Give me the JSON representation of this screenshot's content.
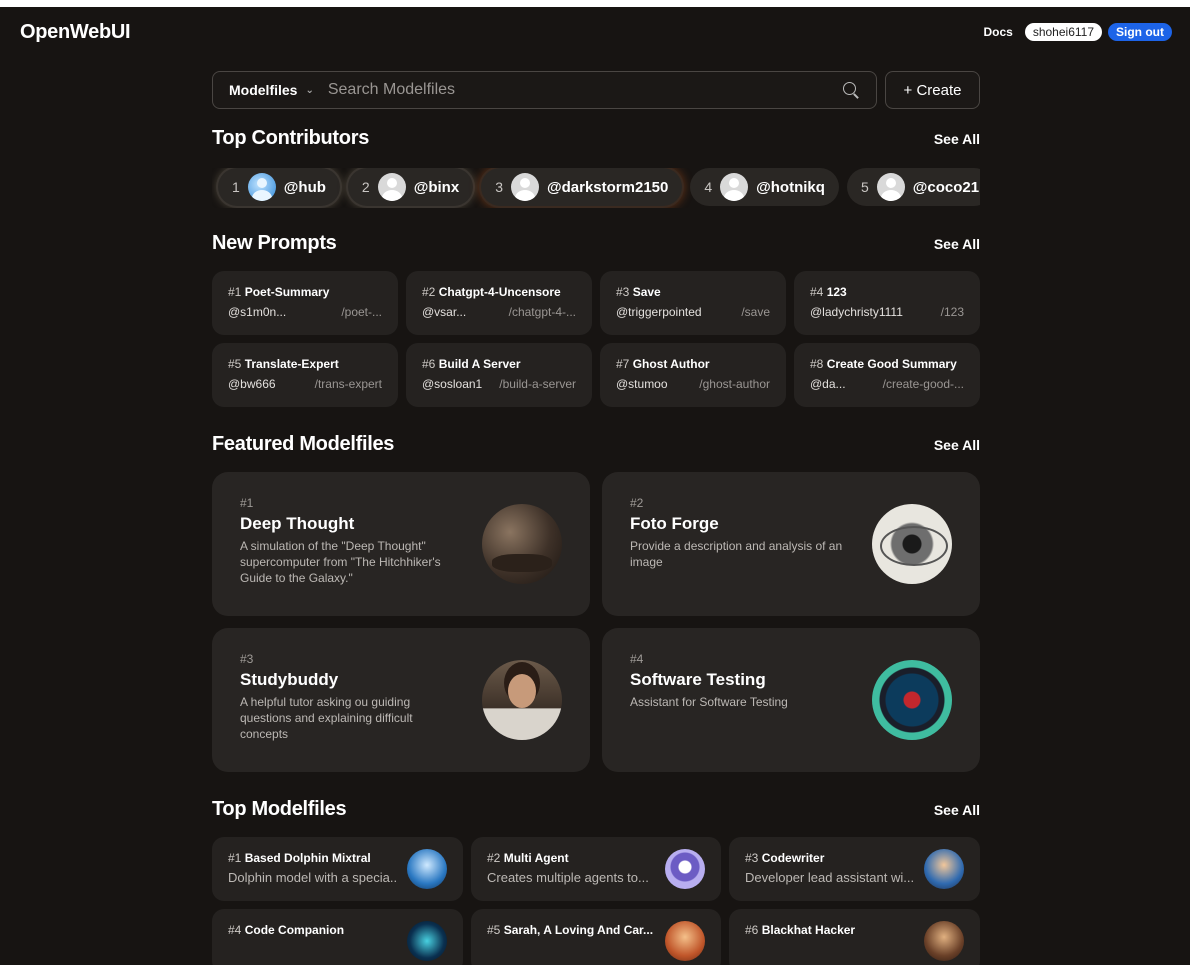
{
  "app": {
    "title": "OpenWebUI"
  },
  "header": {
    "docs": "Docs",
    "username": "shohei6117",
    "signout": "Sign out"
  },
  "search": {
    "selector": "Modelfiles",
    "placeholder": "Search Modelfiles",
    "create": "+ Create"
  },
  "contributors": {
    "title": "Top Contributors",
    "see_all": "See All",
    "items": [
      {
        "rank": "1",
        "name": "@hub"
      },
      {
        "rank": "2",
        "name": "@binx"
      },
      {
        "rank": "3",
        "name": "@darkstorm2150"
      },
      {
        "rank": "4",
        "name": "@hotnikq"
      },
      {
        "rank": "5",
        "name": "@coco21"
      }
    ]
  },
  "prompts": {
    "title": "New Prompts",
    "see_all": "See All",
    "items": [
      {
        "num": "#1",
        "title": "Poet-Summary",
        "user": "@s1m0n...",
        "command": "/poet-..."
      },
      {
        "num": "#2",
        "title": "Chatgpt-4-Uncensore",
        "user": "@vsar...",
        "command": "/chatgpt-4-..."
      },
      {
        "num": "#3",
        "title": "Save",
        "user": "@triggerpointed",
        "command": "/save"
      },
      {
        "num": "#4",
        "title": "123",
        "user": "@ladychristy1111",
        "command": "/123"
      },
      {
        "num": "#5",
        "title": "Translate-Expert",
        "user": "@bw666",
        "command": "/trans-expert"
      },
      {
        "num": "#6",
        "title": "Build A Server",
        "user": "@sosloan1",
        "command": "/build-a-server"
      },
      {
        "num": "#7",
        "title": "Ghost Author",
        "user": "@stumoo",
        "command": "/ghost-author"
      },
      {
        "num": "#8",
        "title": "Create Good Summary",
        "user": "@da...",
        "command": "/create-good-..."
      }
    ]
  },
  "featured": {
    "title": "Featured Modelfiles",
    "see_all": "See All",
    "items": [
      {
        "num": "#1",
        "title": "Deep Thought",
        "desc": "A simulation of the \"Deep Thought\" supercomputer from \"The Hitchhiker's Guide to the Galaxy.\"",
        "image": "deep-thought-image"
      },
      {
        "num": "#2",
        "title": "Foto Forge",
        "desc": "Provide a description and analysis of an image",
        "image": "eye-image"
      },
      {
        "num": "#3",
        "title": "Studybuddy",
        "desc": "A helpful tutor asking ou guiding questions and explaining difficult concepts",
        "image": "tutor-image"
      },
      {
        "num": "#4",
        "title": "Software Testing",
        "desc": "Assistant for Software Testing",
        "image": "bug-hunter-image"
      }
    ]
  },
  "top_modelfiles": {
    "title": "Top Modelfiles",
    "see_all": "See All",
    "items": [
      {
        "num": "#1",
        "title": "Based Dolphin Mixtral",
        "desc": "Dolphin model with a specia..."
      },
      {
        "num": "#2",
        "title": "Multi Agent",
        "desc": "Creates multiple agents to..."
      },
      {
        "num": "#3",
        "title": "Codewriter",
        "desc": "Developer lead assistant wi..."
      },
      {
        "num": "#4",
        "title": "Code Companion",
        "desc": ""
      },
      {
        "num": "#5",
        "title": "Sarah, A Loving And Car...",
        "desc": ""
      },
      {
        "num": "#6",
        "title": "Blackhat Hacker",
        "desc": ""
      }
    ]
  },
  "colors": {
    "background": "#171412",
    "card": "#252220",
    "accent": "#1d64e8"
  }
}
